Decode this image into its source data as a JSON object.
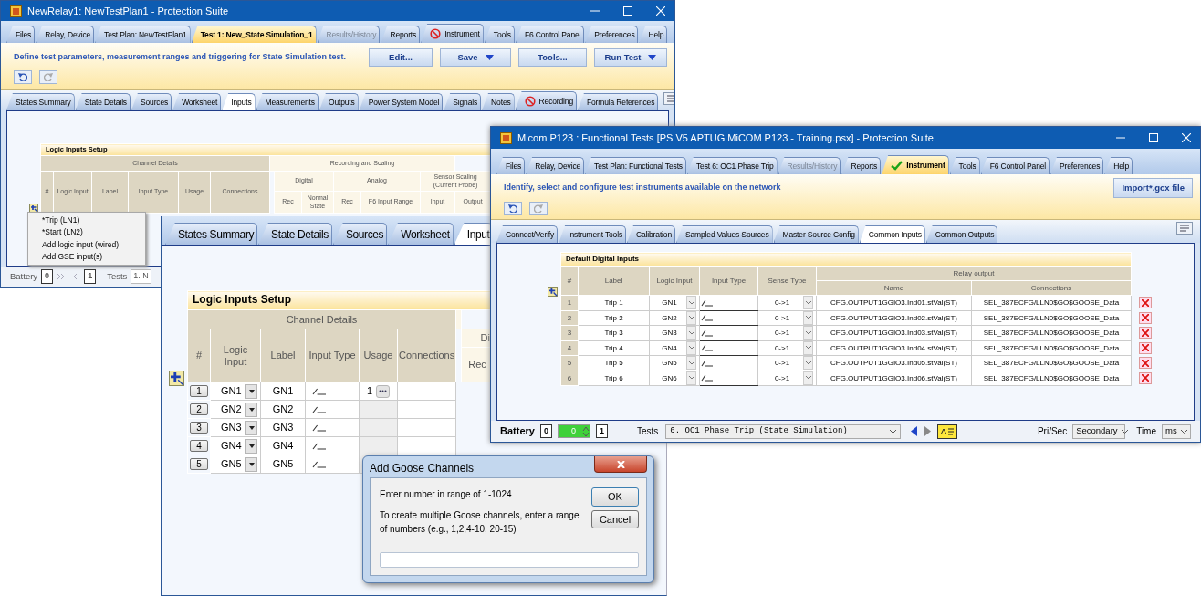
{
  "back_window": {
    "title": "NewRelay1: NewTestPlan1 - Protection Suite",
    "tabs": [
      {
        "label": "Files",
        "selected": false,
        "disabled": false,
        "kind": "plain"
      },
      {
        "label": "Relay, Device",
        "selected": false,
        "disabled": false,
        "kind": "plain"
      },
      {
        "label": "Test Plan: NewTestPlan1",
        "selected": false,
        "disabled": false,
        "kind": "plain"
      },
      {
        "label": "Test 1: New_State Simulation_1",
        "selected": true,
        "disabled": false,
        "kind": "plain"
      },
      {
        "label": "Results/History",
        "selected": false,
        "disabled": true,
        "kind": "plain"
      },
      {
        "label": "Reports",
        "selected": false,
        "disabled": false,
        "kind": "plain"
      },
      {
        "label": "Instrument",
        "selected": false,
        "disabled": false,
        "kind": "blocked"
      },
      {
        "label": "Tools",
        "selected": false,
        "disabled": false,
        "kind": "plain"
      },
      {
        "label": "F6 Control Panel",
        "selected": false,
        "disabled": false,
        "kind": "plain"
      },
      {
        "label": "Preferences",
        "selected": false,
        "disabled": false,
        "kind": "plain"
      },
      {
        "label": "Help",
        "selected": false,
        "disabled": false,
        "kind": "plain"
      }
    ],
    "instruction": "Define test parameters, measurement ranges and triggering for State Simulation test.",
    "buttons": [
      {
        "label": "Edit...",
        "dropdown": false
      },
      {
        "label": "Save",
        "dropdown": true
      },
      {
        "label": "Tools...",
        "dropdown": false
      },
      {
        "label": "Run Test",
        "dropdown": true
      }
    ],
    "subtabs": [
      {
        "label": "States Summary",
        "selected": false,
        "kind": "plain"
      },
      {
        "label": "State Details",
        "selected": false,
        "kind": "plain"
      },
      {
        "label": "Sources",
        "selected": false,
        "kind": "plain"
      },
      {
        "label": "Worksheet",
        "selected": false,
        "kind": "plain"
      },
      {
        "label": "Inputs",
        "selected": true,
        "kind": "plain"
      },
      {
        "label": "Measurements",
        "selected": false,
        "kind": "plain"
      },
      {
        "label": "Outputs",
        "selected": false,
        "kind": "plain"
      },
      {
        "label": "Power System Model",
        "selected": false,
        "kind": "plain"
      },
      {
        "label": "Signals",
        "selected": false,
        "kind": "plain"
      },
      {
        "label": "Notes",
        "selected": false,
        "kind": "plain"
      },
      {
        "label": "Recording",
        "selected": false,
        "kind": "blocked"
      },
      {
        "label": "Formula References",
        "selected": false,
        "kind": "plain"
      }
    ],
    "table": {
      "title": "Logic Inputs Setup",
      "group_1": "Channel Details",
      "columns": [
        "#",
        "Logic Input",
        "Label",
        "Input Type",
        "Usage",
        "Connections"
      ],
      "group_2": "Recording and Scaling",
      "subgroups": [
        "Digital",
        "Analog",
        "Sensor Scaling (Current Probe)"
      ],
      "subcolumns": [
        "Rec",
        "Normal State",
        "Rec",
        "F6 Input Range",
        "Input",
        "Output"
      ]
    },
    "add_menu": [
      "*Trip (LN1)",
      "*Start (LN2)",
      "Add logic input  (wired)",
      "Add GSE input(s)"
    ],
    "status_bar": {
      "battery_label": "Battery",
      "battery_min": "0",
      "battery_max": "1",
      "tests_label": "Tests",
      "test": "1. N"
    }
  },
  "zoom_panel": {
    "tabs": [
      {
        "label": "States Summary",
        "selected": false
      },
      {
        "label": "State Details",
        "selected": false
      },
      {
        "label": "Sources",
        "selected": false
      },
      {
        "label": "Worksheet",
        "selected": false
      },
      {
        "label": "Input",
        "selected": true
      }
    ],
    "table": {
      "title": "Logic Inputs Setup",
      "group_1": "Channel Details",
      "columns": [
        "#",
        "Logic Input",
        "Label",
        "Input Type",
        "Usage",
        "Connections"
      ],
      "group_2_header": "Di",
      "group_2_column": "Rec",
      "rows": [
        {
          "number": "1",
          "logic_input": "GN1",
          "label": "GN1",
          "usage": "1"
        },
        {
          "number": "2",
          "logic_input": "GN2",
          "label": "GN2"
        },
        {
          "number": "3",
          "logic_input": "GN3",
          "label": "GN3"
        },
        {
          "number": "4",
          "logic_input": "GN4",
          "label": "GN4"
        },
        {
          "number": "5",
          "logic_input": "GN5",
          "label": "GN5"
        }
      ]
    }
  },
  "right_window": {
    "title": "Micom P123 : Functional Tests [PS V5 APTUG MiCOM P123 - Training.psx] - Protection Suite",
    "tabs": [
      {
        "label": "Files",
        "selected": false,
        "disabled": false,
        "kind": "plain"
      },
      {
        "label": "Relay, Device",
        "selected": false,
        "disabled": false,
        "kind": "plain"
      },
      {
        "label": "Test Plan: Functional Tests",
        "selected": false,
        "disabled": false,
        "kind": "plain"
      },
      {
        "label": "Test 6:  OC1 Phase Trip",
        "selected": false,
        "disabled": false,
        "kind": "plain"
      },
      {
        "label": "Results/History",
        "selected": false,
        "disabled": true,
        "kind": "plain"
      },
      {
        "label": "Reports",
        "selected": false,
        "disabled": false,
        "kind": "plain"
      },
      {
        "label": "Instrument",
        "selected": true,
        "disabled": false,
        "kind": "checked"
      },
      {
        "label": "Tools",
        "selected": false,
        "disabled": false,
        "kind": "plain"
      },
      {
        "label": "F6 Control Panel",
        "selected": false,
        "disabled": false,
        "kind": "plain"
      },
      {
        "label": "Preferences",
        "selected": false,
        "disabled": false,
        "kind": "plain"
      },
      {
        "label": "Help",
        "selected": false,
        "disabled": false,
        "kind": "plain"
      }
    ],
    "instruction": "Identify, select and configure test instruments available on the network",
    "import_button": "Import*.gcx file",
    "subtabs": [
      {
        "label": "Connect/Verify",
        "selected": false
      },
      {
        "label": "Instrument Tools",
        "selected": false
      },
      {
        "label": "Calibration",
        "selected": false
      },
      {
        "label": "Sampled Values Sources",
        "selected": false
      },
      {
        "label": "Master Source Config",
        "selected": false
      },
      {
        "label": "Common Inputs",
        "selected": true
      },
      {
        "label": "Common Outputs",
        "selected": false
      }
    ],
    "table": {
      "title": "Default Digital Inputs",
      "columns": [
        "#",
        "Label",
        "Logic Input",
        "Input Type",
        "Sense Type"
      ],
      "group": "Relay output",
      "group_columns": [
        "Name",
        "Connections"
      ],
      "rows": [
        {
          "number": "1",
          "label": "Trip 1",
          "logic_input": "GN1",
          "sense_type": "0->1",
          "name": "CFG.OUTPUT1GGIO3.Ind01.stVal(ST)",
          "connections": "SEL_387ECFG/LLN0$GO$GOOSE_Data"
        },
        {
          "number": "2",
          "label": "Trip 2",
          "logic_input": "GN2",
          "sense_type": "0->1",
          "name": "CFG.OUTPUT1GGIO3.Ind02.stVal(ST)",
          "connections": "SEL_387ECFG/LLN0$GO$GOOSE_Data"
        },
        {
          "number": "3",
          "label": "Trip 3",
          "logic_input": "GN3",
          "sense_type": "0->1",
          "name": "CFG.OUTPUT1GGIO3.Ind03.stVal(ST)",
          "connections": "SEL_387ECFG/LLN0$GO$GOOSE_Data"
        },
        {
          "number": "4",
          "label": "Trip 4",
          "logic_input": "GN4",
          "sense_type": "0->1",
          "name": "CFG.OUTPUT1GGIO3.Ind04.stVal(ST)",
          "connections": "SEL_387ECFG/LLN0$GO$GOOSE_Data"
        },
        {
          "number": "5",
          "label": "Trip 5",
          "logic_input": "GN5",
          "sense_type": "0->1",
          "name": "CFG.OUTPUT1GGIO3.Ind05.stVal(ST)",
          "connections": "SEL_387ECFG/LLN0$GO$GOOSE_Data"
        },
        {
          "number": "6",
          "label": "Trip 6",
          "logic_input": "GN6",
          "sense_type": "0->1",
          "name": "CFG.OUTPUT1GGIO3.Ind06.stVal(ST)",
          "connections": "SEL_387ECFG/LLN0$GO$GOOSE_Data"
        }
      ]
    },
    "status_bar": {
      "battery_label": "Battery",
      "battery_min": "0",
      "battery_value": "0",
      "battery_max": "1",
      "tests_label": "Tests",
      "test": "6. OC1 Phase Trip (State Simulation)",
      "pri_sec_label": "Pri/Sec",
      "pri_sec": "Secondary",
      "time_label": "Time",
      "time_unit": "ms"
    }
  },
  "dialog": {
    "title": "Add Goose Channels",
    "message": "Enter number in range of 1-1024",
    "hint": "To create multiple Goose channels, enter a range of numbers  (e.g., 1,2,4-10, 20-15)",
    "buttons": [
      "OK",
      "Cancel"
    ]
  }
}
